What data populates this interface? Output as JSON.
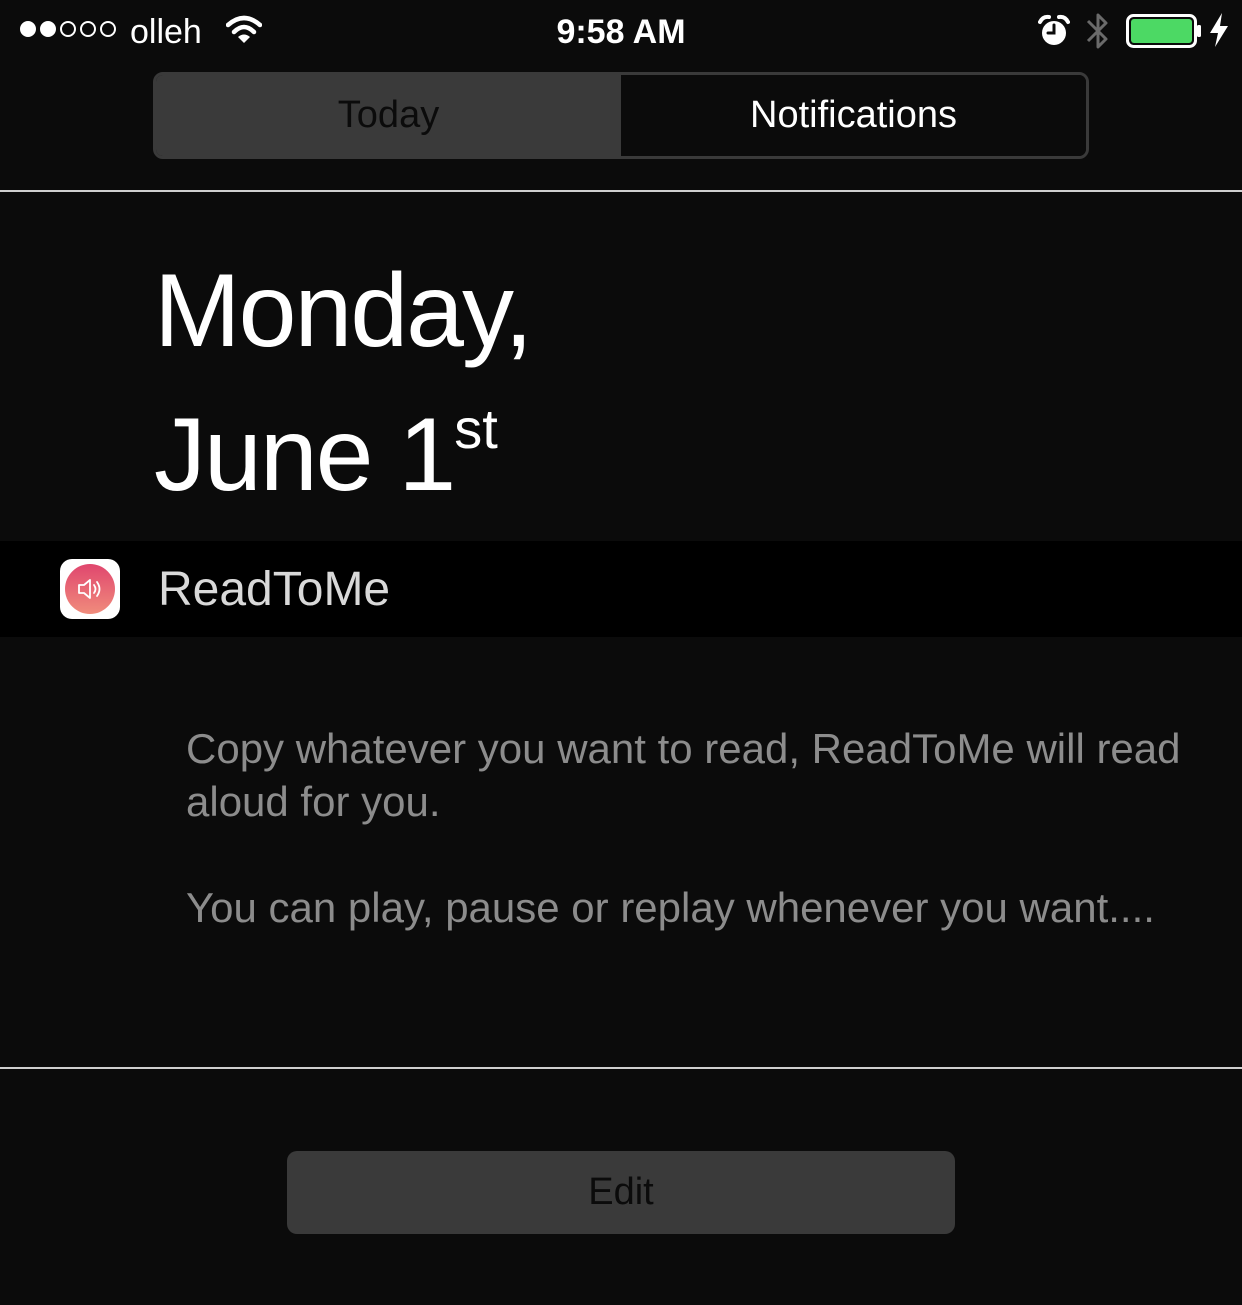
{
  "status_bar": {
    "carrier": "olleh",
    "time": "9:58 AM",
    "signal_bars_filled": 2,
    "signal_bars_total": 5,
    "battery_color": "#4cd964",
    "icons": [
      "wifi-icon",
      "alarm-icon",
      "bluetooth-icon",
      "battery-icon",
      "charging-icon"
    ]
  },
  "segmented_control": {
    "tabs": [
      {
        "label": "Today",
        "selected": false
      },
      {
        "label": "Notifications",
        "selected": true
      }
    ]
  },
  "date": {
    "weekday": "Monday,",
    "month_day": "June 1",
    "suffix": "st"
  },
  "widget": {
    "title": "ReadToMe",
    "icon": "speaker-icon",
    "accent_color": "#e0466e",
    "paragraphs": [
      "Copy whatever you want to read, ReadToMe will read aloud for you.",
      "You can play, pause or replay whenever you want...."
    ]
  },
  "footer": {
    "edit_label": "Edit"
  }
}
